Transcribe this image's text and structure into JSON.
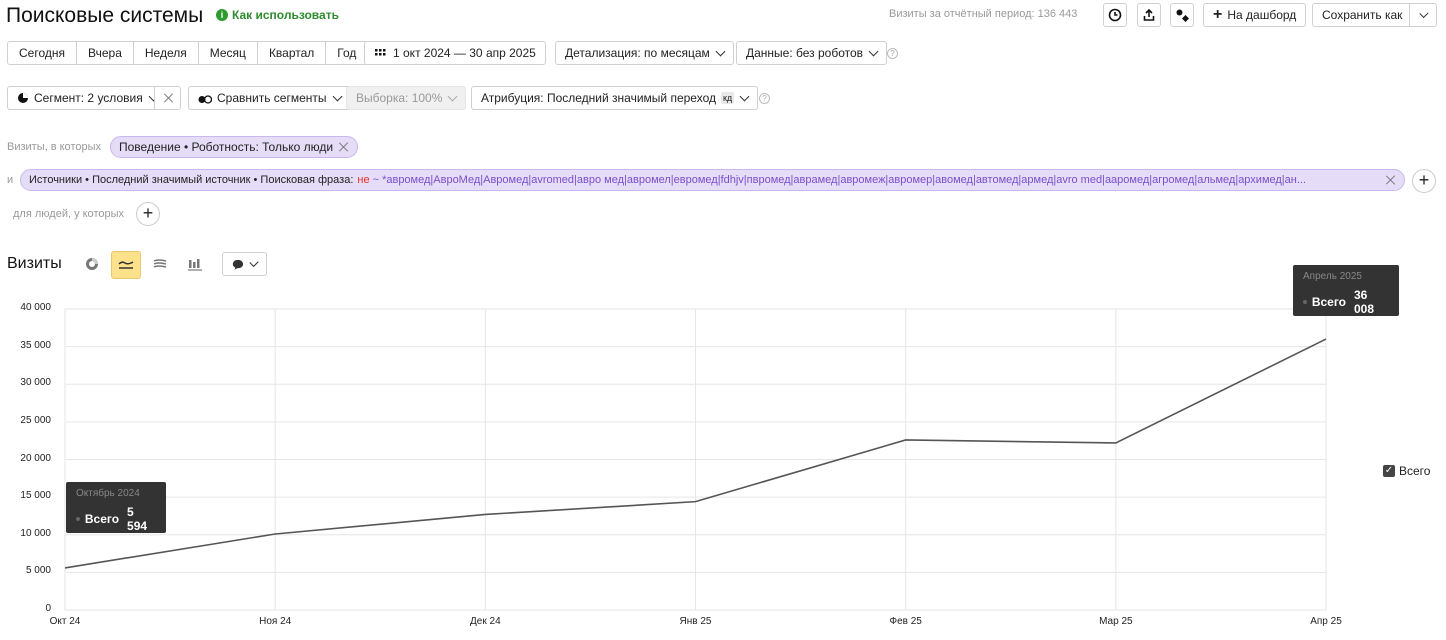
{
  "header": {
    "title": "Поисковые системы",
    "how_to_use": "Как использовать",
    "visits_label": "Визиты за отчётный период: 136 443",
    "dashboard_button": "На дашборд",
    "save_as_button": "Сохранить как"
  },
  "periods": [
    "Сегодня",
    "Вчера",
    "Неделя",
    "Месяц",
    "Квартал",
    "Год"
  ],
  "date_range": "1 окт 2024 — 30 апр 2025",
  "detail_dropdown": "Детализация: по месяцам",
  "data_dropdown": "Данные: без роботов",
  "segment_dropdown": "Сегмент: 2 условия",
  "compare_dropdown": "Сравнить сегменты",
  "sample_dropdown": "Выборка: 100%",
  "attribution_dropdown": "Атрибуция: Последний значимый переход",
  "attribution_badge": "кд",
  "filters": {
    "visits_label": "Визиты, в которых",
    "condition1": "Поведение • Роботность: Только люди",
    "and_label": "и",
    "condition2_prefix": "Источники • Последний значимый источник • Поисковая фраза:",
    "condition2_not": "не",
    "condition2_value": "~ *авромед|АвроМед|Авромед|avromed|авро мед|авромел|евромед|fdhjv|пвромед|аврамед|авромеж|авромер|авомед|автомед|армед|avro med|аaромед|агромед|альмед|архимед|ан...",
    "people_label": "для людей, у которых"
  },
  "section_title": "Визиты",
  "legend": {
    "label": "Всего",
    "checked": true
  },
  "tooltips": {
    "first": {
      "title": "Октябрь 2024",
      "series": "Всего",
      "value": "5 594"
    },
    "last": {
      "title": "Апрель 2025",
      "series": "Всего",
      "value": "36 008"
    }
  },
  "colors": {
    "line": "#555555",
    "grid": "#e6e6e6",
    "chip_bg": "#e5dcf7",
    "highlight": "#fde28b",
    "not_red": "#e5322d",
    "help_green": "#2e9b2e",
    "purple_text": "#7a4fc9"
  },
  "chart_data": {
    "type": "line",
    "categories": [
      "Окт 24",
      "Ноя 24",
      "Дек 24",
      "Янв 25",
      "Фев 25",
      "Мар 25",
      "Апр 25"
    ],
    "series": [
      {
        "name": "Всего",
        "values": [
          5594,
          10100,
          12700,
          14400,
          22600,
          22200,
          36008
        ]
      }
    ],
    "ylim": [
      0,
      40000
    ],
    "yticks": [
      0,
      5000,
      10000,
      15000,
      20000,
      25000,
      30000,
      35000,
      40000
    ],
    "ytick_labels": [
      "0",
      "5 000",
      "10 000",
      "15 000",
      "20 000",
      "25 000",
      "30 000",
      "35 000",
      "40 000"
    ],
    "grid": true,
    "legend": "right"
  }
}
